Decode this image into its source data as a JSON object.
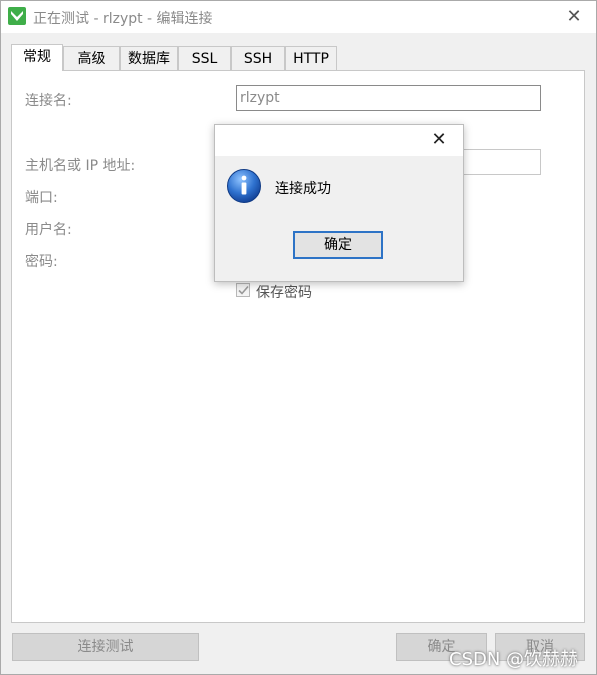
{
  "window": {
    "title": "正在测试 - rlzypt - 编辑连接"
  },
  "tabs": [
    "常规",
    "高级",
    "数据库",
    "SSL",
    "SSH",
    "HTTP"
  ],
  "form": {
    "connection_name_label": "连接名:",
    "connection_name_value": "rlzypt",
    "host_label": "主机名或 IP 地址:",
    "port_label": "端口:",
    "username_label": "用户名:",
    "password_label": "密码:",
    "save_password_label": "保存密码",
    "save_password_checked": true
  },
  "buttons": {
    "test_connection": "连接测试",
    "ok": "确定",
    "cancel": "取消"
  },
  "dialog": {
    "message": "连接成功",
    "ok_label": "确定"
  },
  "watermark": "CSDN @饮赫赫",
  "colors": {
    "accent": "#2d73c6",
    "info_icon": "#1f5fb5",
    "app_icon": "#4caf50"
  }
}
